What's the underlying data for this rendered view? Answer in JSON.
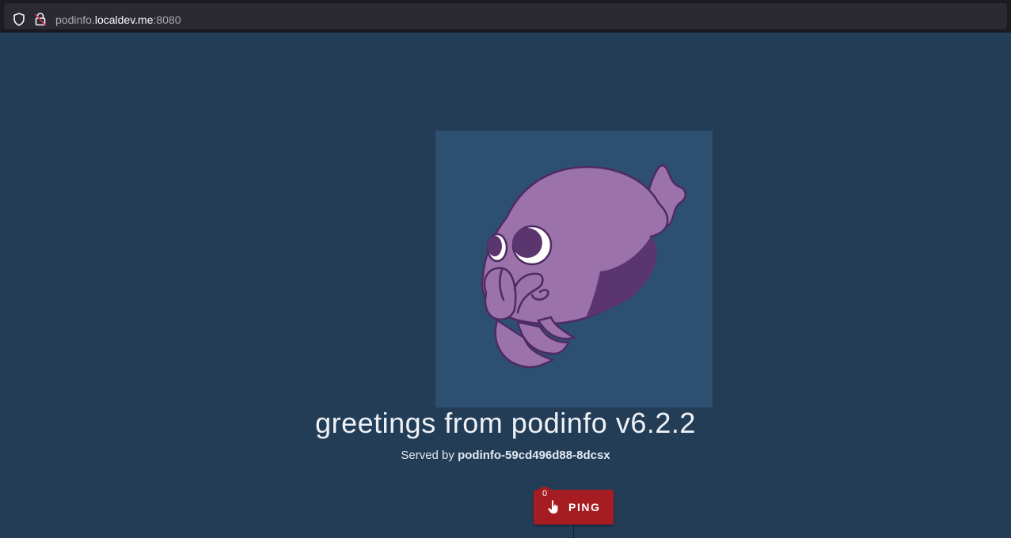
{
  "browser": {
    "url_prefix": "podinfo.",
    "url_host": "localdev.me",
    "url_port": ":8080"
  },
  "icons": {
    "shield": "shield-icon",
    "lock": "lock-icon",
    "logo": "cuttlefish-logo",
    "hand": "hand-pointer-icon"
  },
  "main": {
    "greeting": "greetings from podinfo v6.2.2",
    "served_prefix": "Served by ",
    "pod_name": "podinfo-59cd496d88-8dcsx"
  },
  "ping": {
    "label": "PING",
    "count": "0"
  },
  "colors": {
    "background": "#243d57",
    "logo_background": "#2e5070",
    "ping_button": "#a51d22",
    "logo_body": "#9b72aa"
  }
}
